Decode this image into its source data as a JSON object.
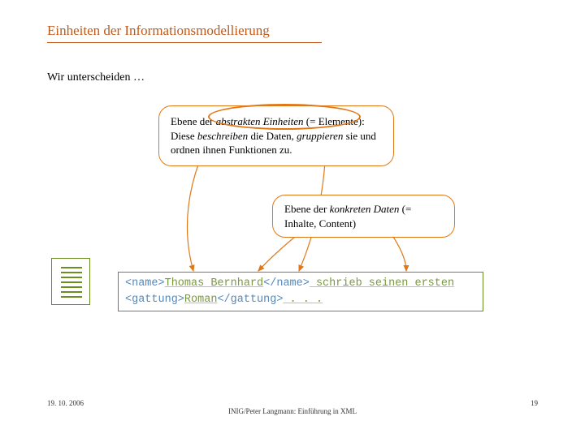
{
  "title": "Einheiten der Informationsmodellierung",
  "intro": "Wir unterscheiden …",
  "bubble1": {
    "line1a": "Ebene der ",
    "line1b": "abstrakten Einheiten",
    "line1c": " (= Elemente): Diese ",
    "line1d": "beschreiben",
    "line1e": " die Daten, ",
    "line1f": "gruppieren",
    "line1g": " sie und ordnen ihnen Funktionen zu."
  },
  "bubble2": {
    "t1": "Ebene der ",
    "t2": "konkreten Daten",
    "t3": " (= Inhalte, Content)"
  },
  "code": {
    "name_open": "<name>",
    "name_text": "Thomas Bernhard",
    "name_close": "</name>",
    "mid1": " schrieb seinen ersten ",
    "gattung_open": "<gattung>",
    "gattung_text": "Roman",
    "gattung_close": "</gattung>",
    "tail": " . . ."
  },
  "footer": {
    "date": "19. 10. 2006",
    "center": "INIG/Peter Langmann: Einführung in XML",
    "page": "19"
  }
}
